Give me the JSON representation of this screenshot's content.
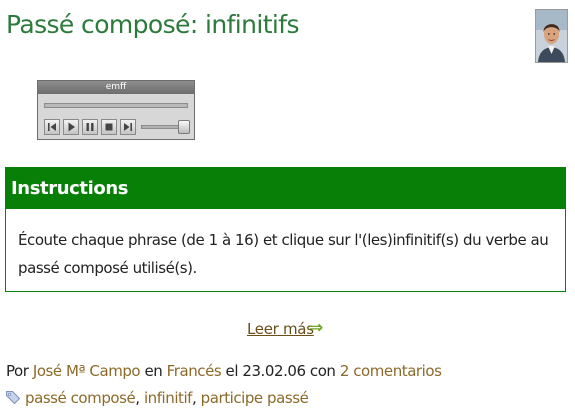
{
  "post": {
    "title": "Passé composé: infinitifs",
    "author_avatar": "author-photo"
  },
  "player": {
    "title": "emff",
    "controls": [
      "previous-icon",
      "play-icon",
      "pause-icon",
      "stop-icon",
      "next-icon"
    ],
    "progress": 0,
    "volume": 1.0
  },
  "instructions": {
    "heading": "Instructions",
    "text": "Écoute chaque phrase (de 1 à 16) et clique sur l'(les)infinitif(s) du verbe au passé composé utilisé(s)."
  },
  "read_more": {
    "label": "Leer más",
    "arrow": "⇒"
  },
  "meta": {
    "by": "Por",
    "author": "José Mª Campo",
    "in": "en",
    "category": "Francés",
    "on": "el",
    "date": "23.02.06",
    "with": "con",
    "comments": "2 comentarios"
  },
  "tags": {
    "icon": "tag-icon",
    "items": [
      "passé composé",
      "infinitif",
      "participe passé"
    ],
    "separator": ","
  },
  "colors": {
    "title": "#2c7a3c",
    "instructions_header": "#088008",
    "link": "#8c6a2a",
    "read_more": "#6b4d16",
    "arrow": "#6aa51e"
  }
}
